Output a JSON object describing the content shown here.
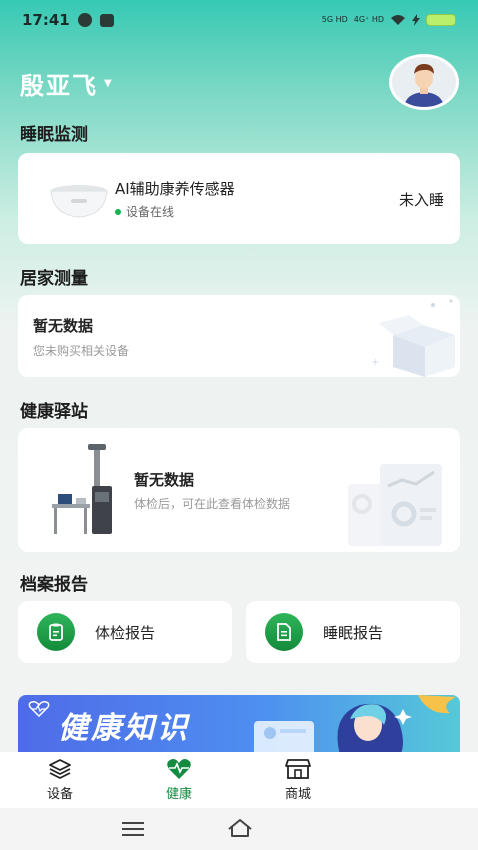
{
  "status_bar": {
    "time": "17:41",
    "signal_1": "5G HD",
    "signal_2": "4G⁺ HD"
  },
  "header": {
    "user_name": "殷亚飞"
  },
  "sleep_section": {
    "title": "睡眠监测",
    "device_name": "AI辅助康养传感器",
    "device_status": "设备在线",
    "sleep_state": "未入睡"
  },
  "home_section": {
    "title": "居家测量",
    "empty_title": "暂无数据",
    "empty_sub": "您未购买相关设备"
  },
  "station_section": {
    "title": "健康驿站",
    "empty_title": "暂无数据",
    "empty_sub": "体检后，可在此查看体检数据"
  },
  "report_section": {
    "title": "档案报告",
    "checkup_label": "体检报告",
    "sleep_label": "睡眠报告"
  },
  "banner": {
    "text": "健康知识"
  },
  "tabbar": {
    "tabs": [
      {
        "label": "设备",
        "icon": "layers-icon"
      },
      {
        "label": "健康",
        "icon": "heart-pulse-icon"
      },
      {
        "label": "商城",
        "icon": "shop-icon"
      }
    ],
    "active_color": "#148a40"
  },
  "colors": {
    "accent_green": "#148a40",
    "online_green": "#16b24c"
  }
}
